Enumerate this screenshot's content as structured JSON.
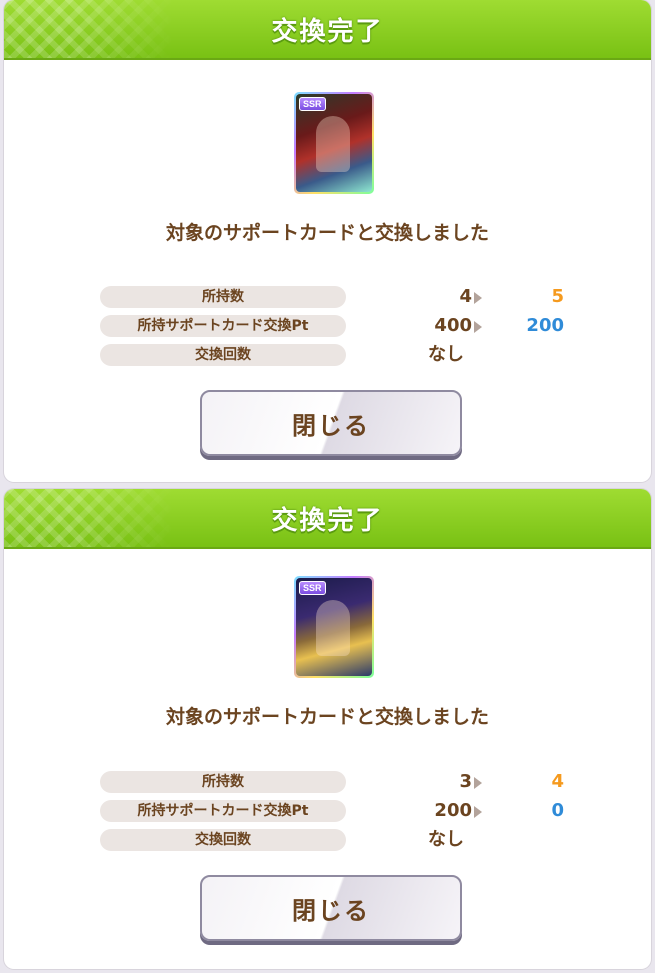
{
  "dialogs": [
    {
      "title": "交換完了",
      "card_badge": "SSR",
      "message": "対象のサポートカードと交換しました",
      "rows": [
        {
          "label": "所持数",
          "from": "4",
          "to": "5"
        },
        {
          "label": "所持サポートカード交換Pt",
          "from": "400",
          "to": "200"
        },
        {
          "label": "交換回数",
          "value": "なし"
        }
      ],
      "close_label": "閉じる"
    },
    {
      "title": "交換完了",
      "card_badge": "SSR",
      "message": "対象のサポートカードと交換しました",
      "rows": [
        {
          "label": "所持数",
          "from": "3",
          "to": "4"
        },
        {
          "label": "所持サポートカード交換Pt",
          "from": "200",
          "to": "0"
        },
        {
          "label": "交換回数",
          "value": "なし"
        }
      ],
      "close_label": "閉じる"
    }
  ],
  "colors": {
    "header_green": "#79c114",
    "text_brown": "#6b4420",
    "count_orange": "#f59a1e",
    "pt_blue": "#2f8bd8"
  }
}
